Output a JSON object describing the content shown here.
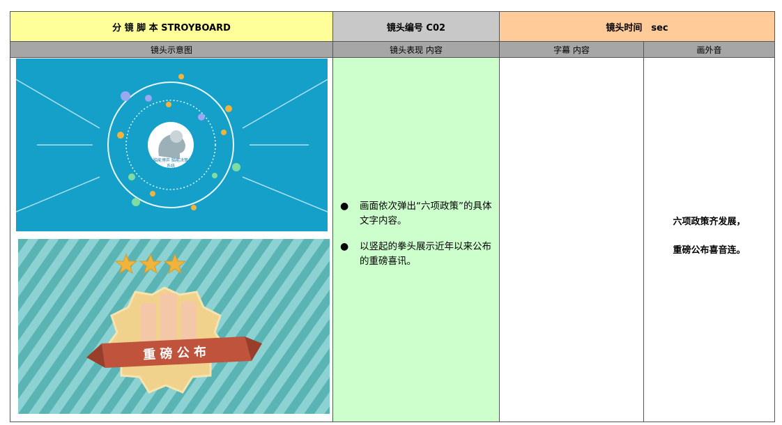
{
  "header": {
    "title": "分 镜 脚 本 STROYBOARD",
    "shot_no": "镜头编号 C02",
    "shot_time": "镜头时间　sec"
  },
  "columns": {
    "image": "镜头示意图",
    "description": "镜头表现 内容",
    "subtitle": "字幕 内容",
    "voiceover": "画外音"
  },
  "content": {
    "bullet_glyph": "●",
    "bullets": [
      "画面依次弹出“六项政策”的具体文字内容。",
      "以竖起的拳头展示近年以来公布的重磅喜讯。"
    ],
    "subtitle": "",
    "voiceover": [
      "六项政策齐发展，",
      "重磅公布喜音连。"
    ]
  },
  "shots": {
    "brain_label_1": "脑能博弈 脑能决策",
    "brain_label_2": "系统",
    "banner_text": "重 磅 公 布"
  },
  "colors": {
    "title_bg": "#ffff99",
    "shot_no_bg": "#c8c8c8",
    "time_bg": "#ffcc99",
    "col_header_bg": "#a6a6a6",
    "desc_bg": "#ccffcc",
    "shot1_bg": "#14a0c8",
    "shot2_stripe_a": "#5ab4b4",
    "shot2_stripe_b": "#8cd2d2",
    "banner": "#c0533c"
  }
}
